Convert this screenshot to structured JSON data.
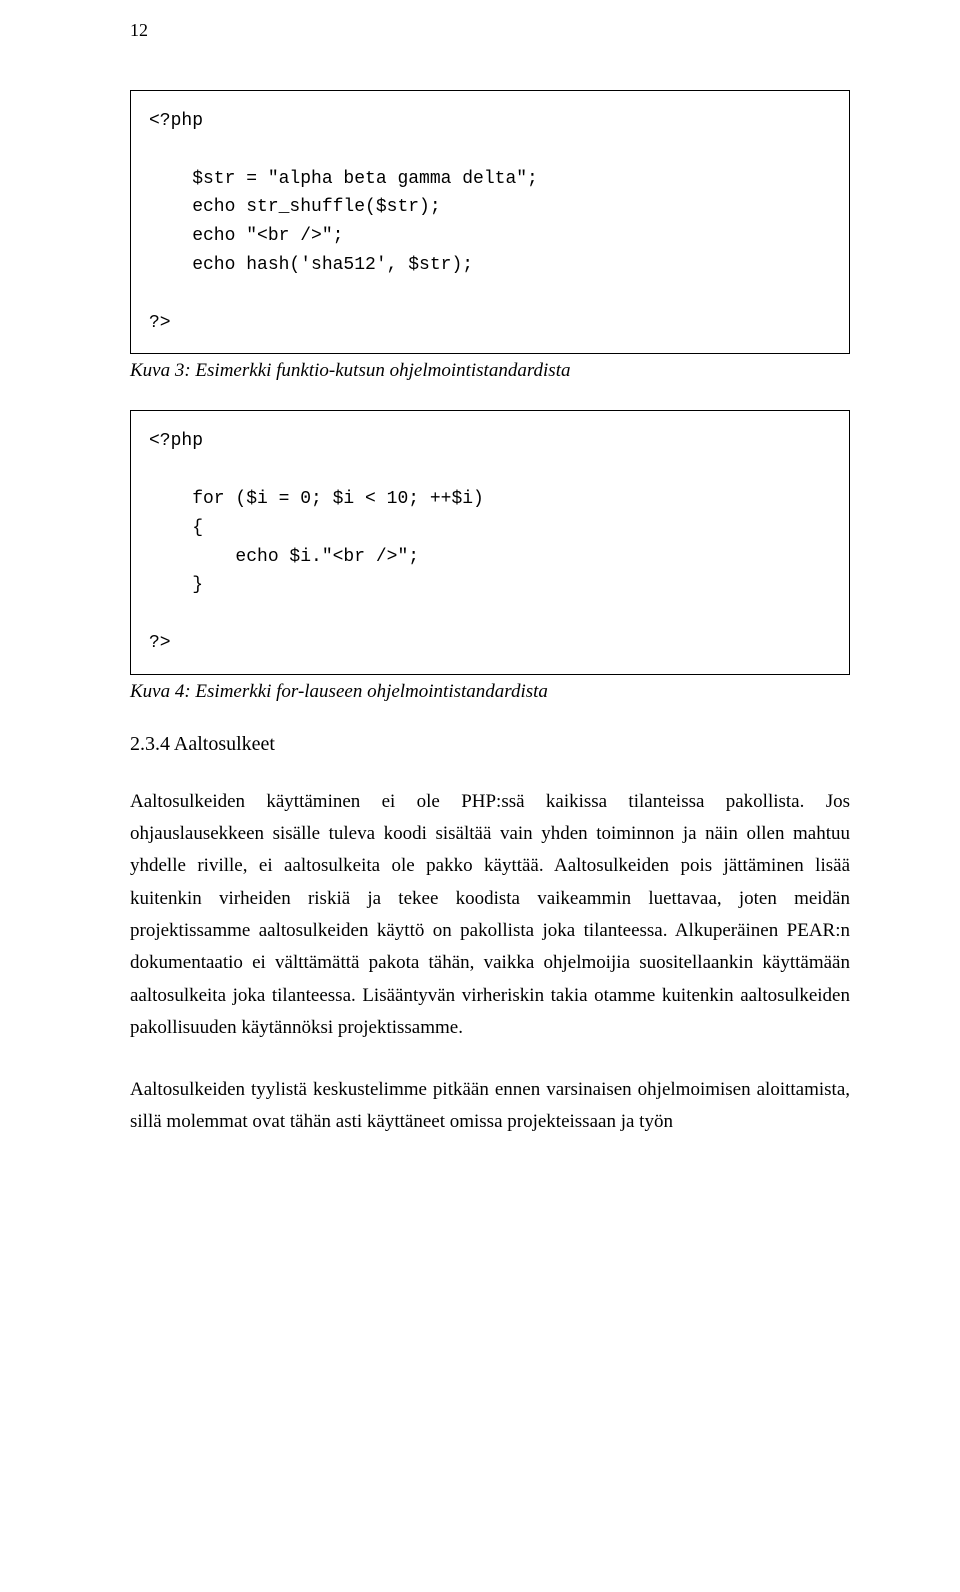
{
  "page_number": "12",
  "code_block_1": "<?php\n\n    $str = \"alpha beta gamma delta\";\n    echo str_shuffle($str);\n    echo \"<br />\";\n    echo hash('sha512', $str);\n\n?>",
  "caption_1": "Kuva 3: Esimerkki funktio-kutsun ohjelmointistandardista",
  "code_block_2": "<?php\n\n    for ($i = 0; $i < 10; ++$i)\n    {\n        echo $i.\"<br />\";\n    }\n\n?>",
  "caption_2": "Kuva 4: Esimerkki for-lauseen ohjelmointistandardista",
  "section_heading": "2.3.4   Aaltosulkeet",
  "paragraph_1": "Aaltosulkeiden käyttäminen ei ole PHP:ssä kaikissa tilanteissa pakollista. Jos ohjauslausekkeen sisälle tuleva koodi sisältää vain yhden toiminnon ja näin ollen mahtuu yhdelle riville, ei aaltosulkeita ole pakko käyttää. Aaltosulkeiden pois jättäminen lisää kuitenkin virheiden riskiä ja tekee koodista vaikeammin luettavaa, joten meidän projektissamme aaltosulkeiden käyttö on pakollista joka tilanteessa. Alkuperäinen PEAR:n dokumentaatio ei välttämättä pakota tähän, vaikka ohjelmoijia suositellaankin käyttämään aaltosulkeita joka tilanteessa. Lisääntyvän virheriskin takia otamme kuitenkin aaltosulkeiden pakollisuuden käytännöksi projektissamme.",
  "paragraph_2": "Aaltosulkeiden tyylistä keskustelimme pitkään ennen varsinaisen ohjelmoimisen aloittamista, sillä molemmat ovat tähän asti käyttäneet omissa projekteissaan ja työn"
}
